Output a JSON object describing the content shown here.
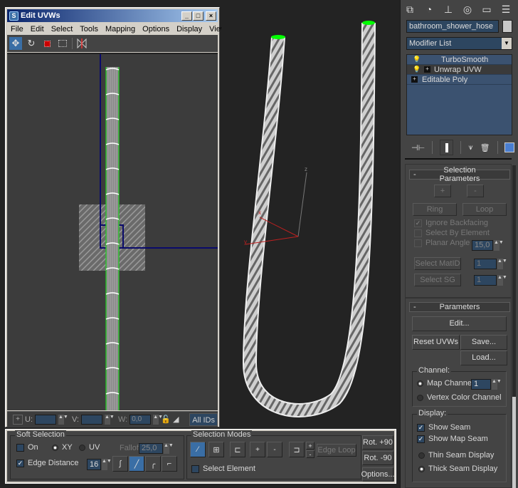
{
  "uvw_window": {
    "title": "Edit UVWs",
    "title_buttons": {
      "minimize": "_",
      "maximize": "□",
      "close": "×"
    },
    "menu": [
      "File",
      "Edit",
      "Select",
      "Tools",
      "Mapping",
      "Options",
      "Display",
      "View"
    ],
    "toolbar": [
      "move-icon",
      "rotate-icon",
      "scale-icon",
      "freeform-icon",
      "mirror-icon"
    ],
    "bottom_bar": {
      "u_label": "U:",
      "u_value": "",
      "v_label": "V:",
      "v_value": "",
      "w_label": "W:",
      "w_value": "0,0",
      "ids_label": "All IDs"
    }
  },
  "viewport": {
    "axis_labels": {
      "x": "x",
      "y": "y",
      "z": "z"
    },
    "colors": {
      "selection": "#00ff00",
      "axis_red": "#c02020",
      "axis_z": "#888888"
    }
  },
  "command_panel": {
    "tabs": [
      "create-icon",
      "modify-icon",
      "hierarchy-icon",
      "motion-icon",
      "display-icon",
      "utilities-icon"
    ],
    "object_name": "bathroom_shower_hose",
    "modifier_list_label": "Modifier List",
    "stack": [
      {
        "label": "TurboSmooth",
        "bulb": true,
        "expand": false,
        "selected": false
      },
      {
        "label": "Unwrap UVW",
        "bulb": true,
        "expand": true,
        "selected": true
      },
      {
        "label": "Editable Poly",
        "bulb": false,
        "expand": true,
        "selected": false
      }
    ],
    "stack_tools": [
      "pin-stack-icon",
      "show-end-result-icon",
      "make-unique-icon",
      "remove-modifier-icon",
      "configure-sets-icon"
    ],
    "selection_parameters": {
      "title": "Selection Parameters",
      "collapse": "-",
      "grow": "+",
      "shrink": "-",
      "ring": "Ring",
      "loop": "Loop",
      "ignore_backfacing": {
        "label": "Ignore Backfacing",
        "checked": true
      },
      "select_by_element": {
        "label": "Select By Element",
        "checked": false
      },
      "planar_angle": {
        "label": "Planar Angle",
        "checked": false,
        "value": "15,0"
      },
      "select_matid": {
        "label": "Select MatID",
        "value": "1"
      },
      "select_sg": {
        "label": "Select SG",
        "value": "1"
      }
    },
    "parameters": {
      "title": "Parameters",
      "collapse": "-",
      "edit": "Edit...",
      "reset": "Reset UVWs",
      "save": "Save...",
      "load": "Load...",
      "channel_label": "Channel:",
      "map_channel": {
        "label": "Map Channel:",
        "value": "1",
        "selected": true
      },
      "vertex_color": {
        "label": "Vertex Color Channel",
        "selected": false
      },
      "display_label": "Display:",
      "show_seam": {
        "label": "Show Seam",
        "checked": true
      },
      "show_map_seam": {
        "label": "Show Map Seam",
        "checked": true
      },
      "thin_seam": {
        "label": "Thin Seam Display",
        "selected": false
      },
      "thick_seam": {
        "label": "Thick Seam Display",
        "selected": true
      }
    }
  },
  "soft_selection": {
    "title": "Soft Selection",
    "on": {
      "label": "On",
      "checked": false
    },
    "xy": {
      "label": "XY",
      "selected": true
    },
    "uv": {
      "label": "UV",
      "selected": false
    },
    "falloff_label": "Falloff:",
    "falloff_value": "25,0",
    "edge_distance": {
      "label": "Edge Distance",
      "checked": true,
      "value": "16"
    }
  },
  "selection_modes": {
    "title": "Selection Modes",
    "plus": "+",
    "minus": "-",
    "edge_loop": "Edge Loop",
    "select_element": {
      "label": "Select Element",
      "checked": false
    },
    "rot_plus": "Rot. +90",
    "rot_minus": "Rot. -90",
    "options": "Options..."
  }
}
